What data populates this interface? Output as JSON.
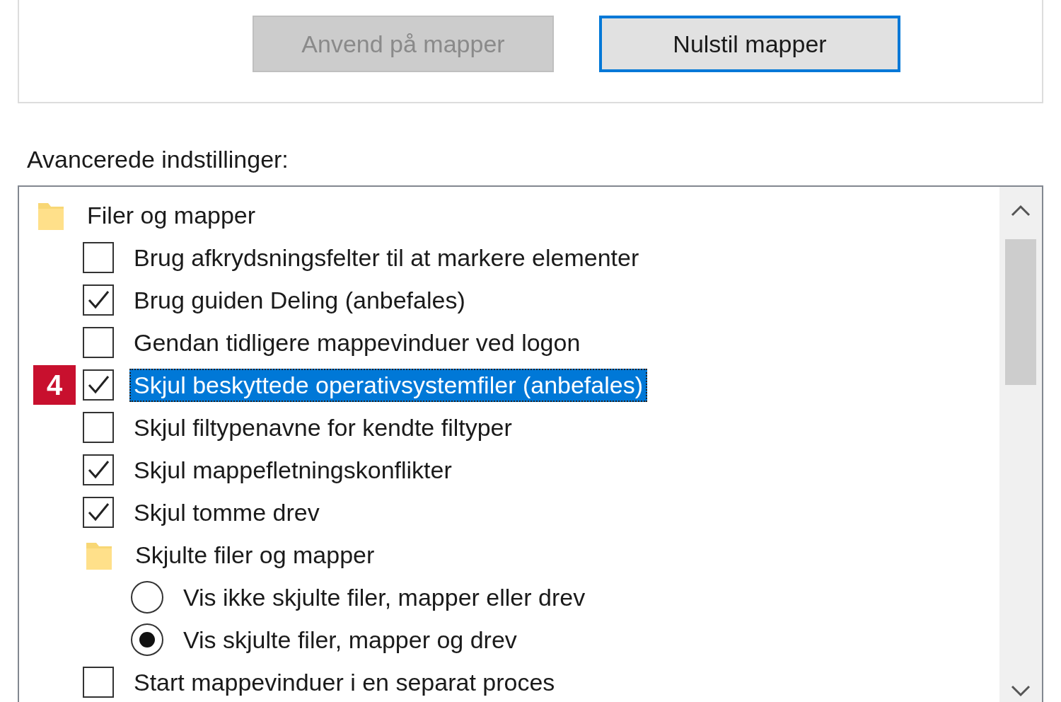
{
  "folder_view_buttons": [
    {
      "label": "Anvend på mapper",
      "disabled": true,
      "focused": false
    },
    {
      "label": "Nulstil mapper",
      "disabled": false,
      "focused": true
    }
  ],
  "advanced_settings": {
    "label": "Avancerede indstillinger:",
    "items": [
      {
        "kind": "folder",
        "label": "Filer og mapper",
        "children": [
          {
            "kind": "checkbox",
            "label": "Brug afkrydsningsfelter til at markere elementer",
            "checked": false,
            "highlighted": false
          },
          {
            "kind": "checkbox",
            "label": "Brug guiden Deling (anbefales)",
            "checked": true,
            "highlighted": false
          },
          {
            "kind": "checkbox",
            "label": "Gendan tidligere mappevinduer ved logon",
            "checked": false,
            "highlighted": false
          },
          {
            "kind": "checkbox",
            "label": "Skjul beskyttede operativsystemfiler (anbefales)",
            "checked": true,
            "highlighted": true,
            "callout": "4"
          },
          {
            "kind": "checkbox",
            "label": "Skjul filtypenavne for kendte filtyper",
            "checked": false,
            "highlighted": false
          },
          {
            "kind": "checkbox",
            "label": "Skjul mappefletningskonflikter",
            "checked": true,
            "highlighted": false
          },
          {
            "kind": "checkbox",
            "label": "Skjul tomme drev",
            "checked": true,
            "highlighted": false
          },
          {
            "kind": "folder",
            "label": "Skjulte filer og mapper",
            "children": [
              {
                "kind": "radio",
                "label": "Vis ikke skjulte filer, mapper eller drev",
                "selected": false
              },
              {
                "kind": "radio",
                "label": "Vis skjulte filer, mapper og drev",
                "selected": true
              }
            ]
          },
          {
            "kind": "checkbox",
            "label": "Start mappevinduer i en separat proces",
            "checked": false,
            "highlighted": false
          }
        ]
      }
    ]
  }
}
